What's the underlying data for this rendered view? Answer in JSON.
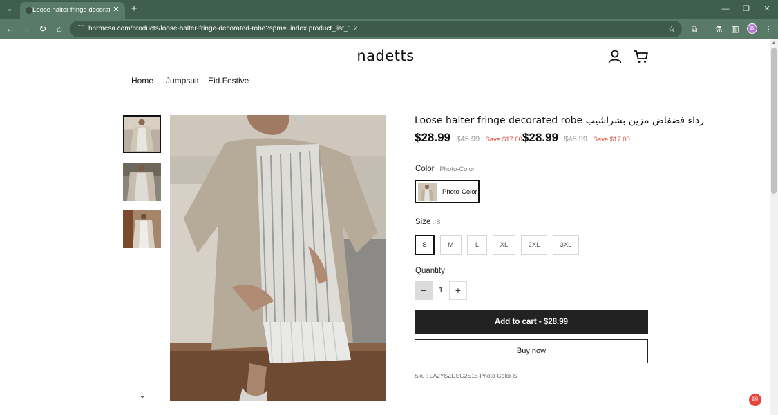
{
  "browser": {
    "tab_title": "Loose halter fringe decorated r",
    "url": "hnrmesa.com/products/loose-halter-fringe-decorated-robe?spm=..index.product_list_1.2",
    "profile_initial": "B"
  },
  "store": {
    "logo": "nadetts",
    "nav": [
      "Home",
      "Jumpsuit",
      "Eid Festive"
    ]
  },
  "product": {
    "title": "Loose halter fringe decorated robe رداء فضفاض مزين بشراشيب",
    "price": "$28.99",
    "compare_price": "$45.99",
    "save": "Save $17.00",
    "price_2": "$28.99",
    "compare_price_2": "$45.99",
    "save_2": "Save $17.00",
    "color_label": "Color",
    "color_sep": " : ",
    "color_value": "Photo-Color",
    "color_option": "Photo-Color",
    "size_label": "Size",
    "size_sep": " : ",
    "size_value": "S",
    "sizes": [
      "S",
      "M",
      "L",
      "XL",
      "2XL",
      "3XL"
    ],
    "selected_size": "S",
    "quantity_label": "Quantity",
    "quantity": "1",
    "add_to_cart": "Add to cart  -  $28.99",
    "buy_now": "Buy now",
    "sku": "Sku : LA2YSZDSG2S15-Photo-Color-S"
  },
  "colors": {
    "tab_bar": "#3f5e4e",
    "toolbar": "#5a7a68",
    "sale": "#e24a3b",
    "cart_button": "#222222"
  }
}
